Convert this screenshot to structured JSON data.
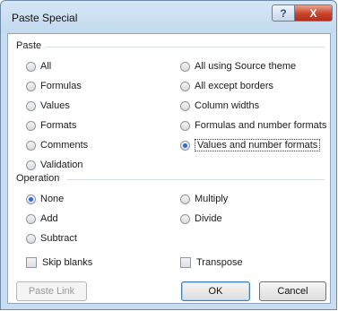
{
  "window": {
    "title": "Paste Special",
    "help_label": "?",
    "close_label": "X"
  },
  "paste": {
    "header": "Paste",
    "left_options": [
      {
        "label": "All",
        "selected": false
      },
      {
        "label": "Formulas",
        "selected": false
      },
      {
        "label": "Values",
        "selected": false
      },
      {
        "label": "Formats",
        "selected": false
      },
      {
        "label": "Comments",
        "selected": false
      },
      {
        "label": "Validation",
        "selected": false
      }
    ],
    "right_options": [
      {
        "label": "All using Source theme",
        "selected": false
      },
      {
        "label": "All except borders",
        "selected": false
      },
      {
        "label": "Column widths",
        "selected": false
      },
      {
        "label": "Formulas and number formats",
        "selected": false
      },
      {
        "label": "Values and number formats",
        "selected": true
      }
    ]
  },
  "operation": {
    "header": "Operation",
    "left_options": [
      {
        "label": "None",
        "selected": true
      },
      {
        "label": "Add",
        "selected": false
      },
      {
        "label": "Subtract",
        "selected": false
      }
    ],
    "right_options": [
      {
        "label": "Multiply",
        "selected": false
      },
      {
        "label": "Divide",
        "selected": false
      }
    ]
  },
  "checkboxes": {
    "skip_blanks": {
      "label": "Skip blanks",
      "checked": false
    },
    "transpose": {
      "label": "Transpose",
      "checked": false
    }
  },
  "buttons": {
    "paste_link": "Paste Link",
    "ok": "OK",
    "cancel": "Cancel"
  }
}
